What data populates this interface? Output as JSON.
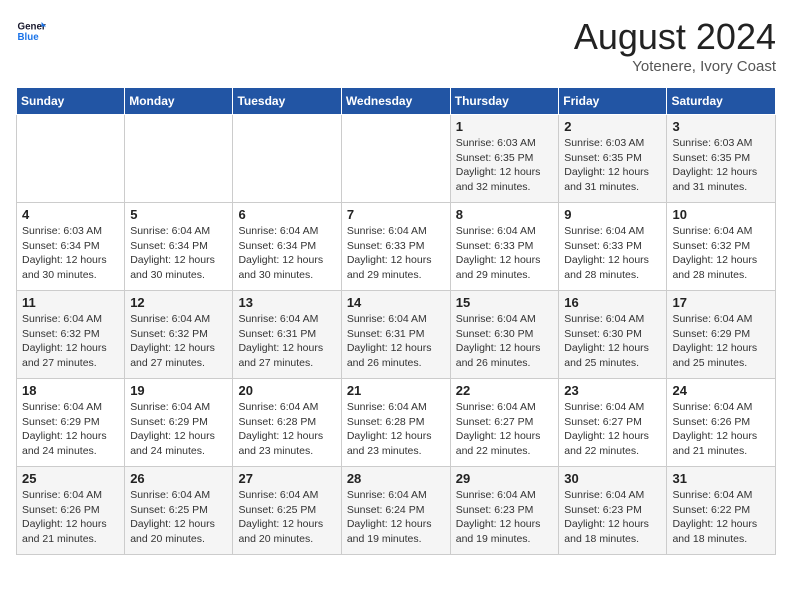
{
  "header": {
    "logo_general": "General",
    "logo_blue": "Blue",
    "month_year": "August 2024",
    "location": "Yotenere, Ivory Coast"
  },
  "days_of_week": [
    "Sunday",
    "Monday",
    "Tuesday",
    "Wednesday",
    "Thursday",
    "Friday",
    "Saturday"
  ],
  "weeks": [
    [
      {
        "day": "",
        "sunrise": "",
        "sunset": "",
        "daylight": ""
      },
      {
        "day": "",
        "sunrise": "",
        "sunset": "",
        "daylight": ""
      },
      {
        "day": "",
        "sunrise": "",
        "sunset": "",
        "daylight": ""
      },
      {
        "day": "",
        "sunrise": "",
        "sunset": "",
        "daylight": ""
      },
      {
        "day": "1",
        "sunrise": "Sunrise: 6:03 AM",
        "sunset": "Sunset: 6:35 PM",
        "daylight": "Daylight: 12 hours and 32 minutes."
      },
      {
        "day": "2",
        "sunrise": "Sunrise: 6:03 AM",
        "sunset": "Sunset: 6:35 PM",
        "daylight": "Daylight: 12 hours and 31 minutes."
      },
      {
        "day": "3",
        "sunrise": "Sunrise: 6:03 AM",
        "sunset": "Sunset: 6:35 PM",
        "daylight": "Daylight: 12 hours and 31 minutes."
      }
    ],
    [
      {
        "day": "4",
        "sunrise": "Sunrise: 6:03 AM",
        "sunset": "Sunset: 6:34 PM",
        "daylight": "Daylight: 12 hours and 30 minutes."
      },
      {
        "day": "5",
        "sunrise": "Sunrise: 6:04 AM",
        "sunset": "Sunset: 6:34 PM",
        "daylight": "Daylight: 12 hours and 30 minutes."
      },
      {
        "day": "6",
        "sunrise": "Sunrise: 6:04 AM",
        "sunset": "Sunset: 6:34 PM",
        "daylight": "Daylight: 12 hours and 30 minutes."
      },
      {
        "day": "7",
        "sunrise": "Sunrise: 6:04 AM",
        "sunset": "Sunset: 6:33 PM",
        "daylight": "Daylight: 12 hours and 29 minutes."
      },
      {
        "day": "8",
        "sunrise": "Sunrise: 6:04 AM",
        "sunset": "Sunset: 6:33 PM",
        "daylight": "Daylight: 12 hours and 29 minutes."
      },
      {
        "day": "9",
        "sunrise": "Sunrise: 6:04 AM",
        "sunset": "Sunset: 6:33 PM",
        "daylight": "Daylight: 12 hours and 28 minutes."
      },
      {
        "day": "10",
        "sunrise": "Sunrise: 6:04 AM",
        "sunset": "Sunset: 6:32 PM",
        "daylight": "Daylight: 12 hours and 28 minutes."
      }
    ],
    [
      {
        "day": "11",
        "sunrise": "Sunrise: 6:04 AM",
        "sunset": "Sunset: 6:32 PM",
        "daylight": "Daylight: 12 hours and 27 minutes."
      },
      {
        "day": "12",
        "sunrise": "Sunrise: 6:04 AM",
        "sunset": "Sunset: 6:32 PM",
        "daylight": "Daylight: 12 hours and 27 minutes."
      },
      {
        "day": "13",
        "sunrise": "Sunrise: 6:04 AM",
        "sunset": "Sunset: 6:31 PM",
        "daylight": "Daylight: 12 hours and 27 minutes."
      },
      {
        "day": "14",
        "sunrise": "Sunrise: 6:04 AM",
        "sunset": "Sunset: 6:31 PM",
        "daylight": "Daylight: 12 hours and 26 minutes."
      },
      {
        "day": "15",
        "sunrise": "Sunrise: 6:04 AM",
        "sunset": "Sunset: 6:30 PM",
        "daylight": "Daylight: 12 hours and 26 minutes."
      },
      {
        "day": "16",
        "sunrise": "Sunrise: 6:04 AM",
        "sunset": "Sunset: 6:30 PM",
        "daylight": "Daylight: 12 hours and 25 minutes."
      },
      {
        "day": "17",
        "sunrise": "Sunrise: 6:04 AM",
        "sunset": "Sunset: 6:29 PM",
        "daylight": "Daylight: 12 hours and 25 minutes."
      }
    ],
    [
      {
        "day": "18",
        "sunrise": "Sunrise: 6:04 AM",
        "sunset": "Sunset: 6:29 PM",
        "daylight": "Daylight: 12 hours and 24 minutes."
      },
      {
        "day": "19",
        "sunrise": "Sunrise: 6:04 AM",
        "sunset": "Sunset: 6:29 PM",
        "daylight": "Daylight: 12 hours and 24 minutes."
      },
      {
        "day": "20",
        "sunrise": "Sunrise: 6:04 AM",
        "sunset": "Sunset: 6:28 PM",
        "daylight": "Daylight: 12 hours and 23 minutes."
      },
      {
        "day": "21",
        "sunrise": "Sunrise: 6:04 AM",
        "sunset": "Sunset: 6:28 PM",
        "daylight": "Daylight: 12 hours and 23 minutes."
      },
      {
        "day": "22",
        "sunrise": "Sunrise: 6:04 AM",
        "sunset": "Sunset: 6:27 PM",
        "daylight": "Daylight: 12 hours and 22 minutes."
      },
      {
        "day": "23",
        "sunrise": "Sunrise: 6:04 AM",
        "sunset": "Sunset: 6:27 PM",
        "daylight": "Daylight: 12 hours and 22 minutes."
      },
      {
        "day": "24",
        "sunrise": "Sunrise: 6:04 AM",
        "sunset": "Sunset: 6:26 PM",
        "daylight": "Daylight: 12 hours and 21 minutes."
      }
    ],
    [
      {
        "day": "25",
        "sunrise": "Sunrise: 6:04 AM",
        "sunset": "Sunset: 6:26 PM",
        "daylight": "Daylight: 12 hours and 21 minutes."
      },
      {
        "day": "26",
        "sunrise": "Sunrise: 6:04 AM",
        "sunset": "Sunset: 6:25 PM",
        "daylight": "Daylight: 12 hours and 20 minutes."
      },
      {
        "day": "27",
        "sunrise": "Sunrise: 6:04 AM",
        "sunset": "Sunset: 6:25 PM",
        "daylight": "Daylight: 12 hours and 20 minutes."
      },
      {
        "day": "28",
        "sunrise": "Sunrise: 6:04 AM",
        "sunset": "Sunset: 6:24 PM",
        "daylight": "Daylight: 12 hours and 19 minutes."
      },
      {
        "day": "29",
        "sunrise": "Sunrise: 6:04 AM",
        "sunset": "Sunset: 6:23 PM",
        "daylight": "Daylight: 12 hours and 19 minutes."
      },
      {
        "day": "30",
        "sunrise": "Sunrise: 6:04 AM",
        "sunset": "Sunset: 6:23 PM",
        "daylight": "Daylight: 12 hours and 18 minutes."
      },
      {
        "day": "31",
        "sunrise": "Sunrise: 6:04 AM",
        "sunset": "Sunset: 6:22 PM",
        "daylight": "Daylight: 12 hours and 18 minutes."
      }
    ]
  ]
}
